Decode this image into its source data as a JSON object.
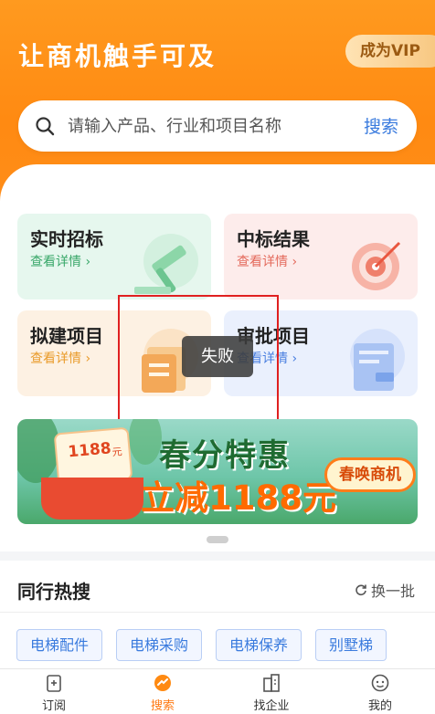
{
  "header": {
    "slogan": "让商机触手可及",
    "vip_label": "成为VIP"
  },
  "search": {
    "placeholder": "请输入产品、行业和项目名称",
    "button_label": "搜索"
  },
  "cards": [
    {
      "title": "实时招标",
      "link": "查看详情",
      "accent": "#3aa86a",
      "icon": "gavel-icon"
    },
    {
      "title": "中标结果",
      "link": "查看详情",
      "accent": "#e46a5c",
      "icon": "target-icon"
    },
    {
      "title": "拟建项目",
      "link": "查看详情",
      "accent": "#e99b2a",
      "icon": "document-stack-icon"
    },
    {
      "title": "审批项目",
      "link": "查看详情",
      "accent": "#4a7fe0",
      "icon": "approval-stamp-icon"
    }
  ],
  "toast": {
    "message": "失败"
  },
  "banner": {
    "coupon_amount": "1188",
    "coupon_unit": "元",
    "line1": "春分特惠",
    "line2": "立减1188元",
    "button_label": "春唤商机"
  },
  "hot_search": {
    "title": "同行热搜",
    "refresh_label": "换一批",
    "tags": [
      "电梯配件",
      "电梯采购",
      "电梯保养",
      "别墅梯"
    ]
  },
  "nav": {
    "items": [
      {
        "label": "订阅",
        "icon": "subscribe-icon",
        "active": false
      },
      {
        "label": "搜索",
        "icon": "search-tab-icon",
        "active": true
      },
      {
        "label": "找企业",
        "icon": "company-icon",
        "active": false
      },
      {
        "label": "我的",
        "icon": "profile-icon",
        "active": false
      }
    ]
  },
  "colors": {
    "brand_orange": "#ff8a12",
    "link_blue": "#3a7bde",
    "toast_bg": "#3c3c3c"
  }
}
